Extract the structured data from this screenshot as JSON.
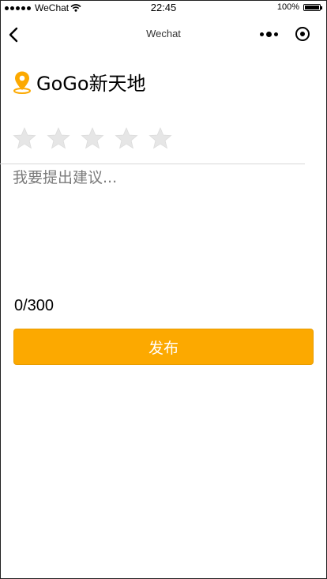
{
  "status_bar": {
    "carrier": "WeChat",
    "time": "22:45",
    "battery": "100%",
    "battery_level": 1.0
  },
  "nav": {
    "title": "Wechat"
  },
  "store": {
    "name": "GoGo新天地",
    "icon": "location-pin-icon",
    "accent_color": "#fca900"
  },
  "rating": {
    "max_stars": 5,
    "value": 0
  },
  "feedback": {
    "placeholder": "我要提出建议...",
    "value": "",
    "counter": "0/300"
  },
  "actions": {
    "submit_label": "发布"
  },
  "colors": {
    "primary": "#fca900",
    "star_empty": "#e6e6e6"
  }
}
